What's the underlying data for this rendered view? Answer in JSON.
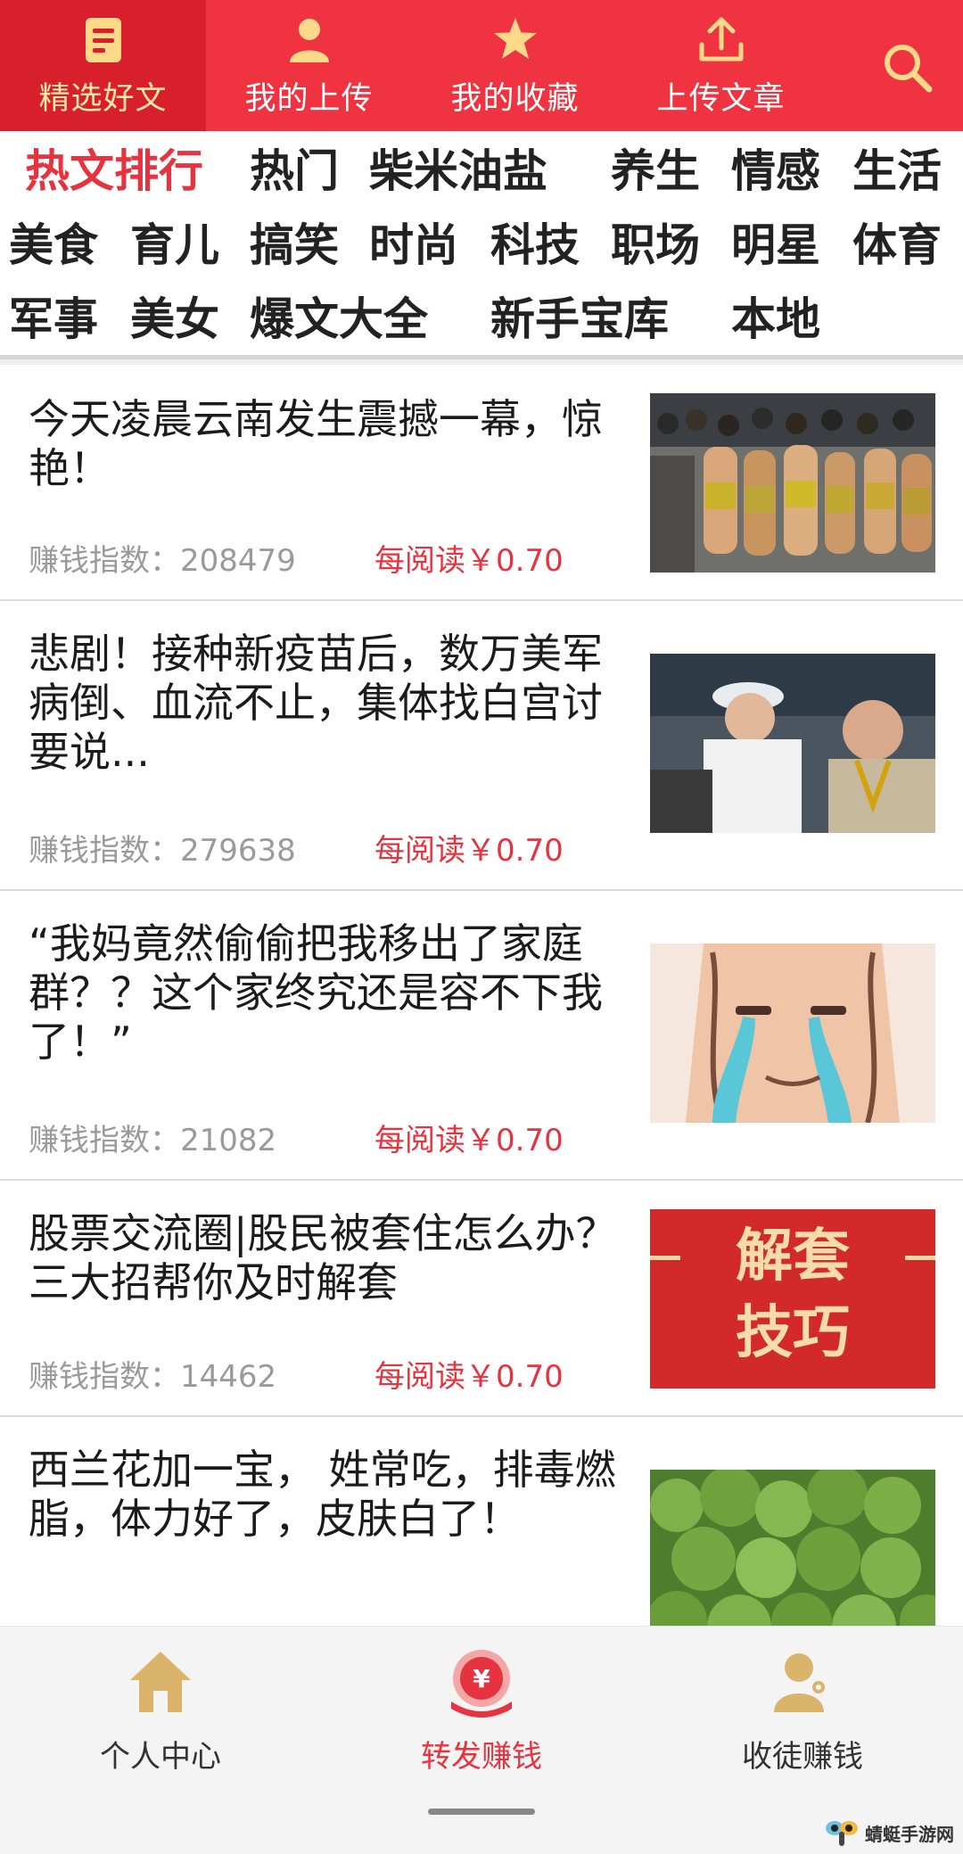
{
  "topbar": {
    "tabs": [
      {
        "label": "精选好文",
        "icon": "article-icon",
        "active": true
      },
      {
        "label": "我的上传",
        "icon": "user-icon",
        "active": false
      },
      {
        "label": "我的收藏",
        "icon": "star-icon",
        "active": false
      },
      {
        "label": "上传文章",
        "icon": "upload-icon",
        "active": false
      }
    ],
    "search_icon": "search-icon",
    "color": "#ef3340",
    "active_color": "#d81f2c"
  },
  "categories": [
    "热文排行",
    "热门",
    "柴米油盐",
    "养生",
    "情感",
    "生活",
    "美食",
    "育儿",
    "搞笑",
    "时尚",
    "科技",
    "职场",
    "明星",
    "体育",
    "军事",
    "美女",
    "爆文大全",
    "新手宝库",
    "本地"
  ],
  "articles": [
    {
      "title": "今天凌晨云南发生震撼一幕，惊艳！",
      "score_label": "赚钱指数：",
      "score": "208479",
      "reward": "每阅读￥0.70"
    },
    {
      "title": "悲剧！接种新疫苗后，数万美军病倒、血流不止，集体找白宫讨要说...",
      "score_label": "赚钱指数：",
      "score": "279638",
      "reward": "每阅读￥0.70"
    },
    {
      "title": "“我妈竟然偷偷把我移出了家庭群？？这个家终究还是容不下我了！”",
      "score_label": "赚钱指数：",
      "score": "21082",
      "reward": "每阅读￥0.70"
    },
    {
      "title": "股票交流圈|股民被套住怎么办？三大招帮你及时解套",
      "score_label": "赚钱指数：",
      "score": "14462",
      "reward": "每阅读￥0.70",
      "thumb_text": [
        "解套",
        "技巧"
      ]
    },
    {
      "title": "西兰花加一宝， 姓常吃，排毒燃脂，体力好了，皮肤白了！",
      "score_label": "",
      "score": "",
      "reward": ""
    }
  ],
  "bottom_nav": [
    {
      "label": "个人中心",
      "icon": "home-icon",
      "active": false
    },
    {
      "label": "转发赚钱",
      "icon": "yuan-coin-icon",
      "active": true
    },
    {
      "label": "收徒赚钱",
      "icon": "recruit-user-icon",
      "active": false
    }
  ],
  "watermark": "蜻蜓手游网",
  "accent": "#e5333f",
  "gold": "#d9b46a"
}
